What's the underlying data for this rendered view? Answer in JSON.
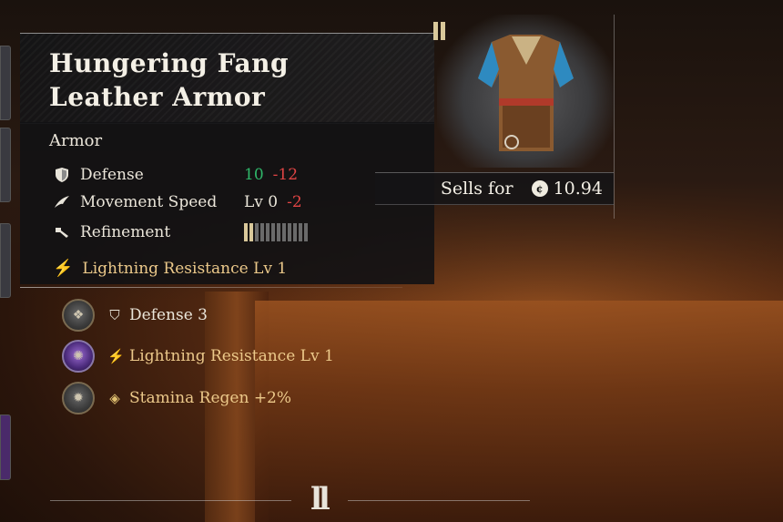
{
  "item": {
    "name_line1": "Hungering Fang",
    "name_line2": "Leather Armor",
    "category": "Armor"
  },
  "stats": [
    {
      "icon": "shield-icon",
      "label": "Defense",
      "value": "10",
      "delta": "-12"
    },
    {
      "icon": "wing-icon",
      "label": "Movement Speed",
      "value": "Lv 0",
      "delta": "-2"
    },
    {
      "icon": "hammer-icon",
      "label": "Refinement",
      "refinement_level": 2,
      "refinement_max": 12
    }
  ],
  "skill": {
    "icon": "lightning-icon",
    "label": "Lightning Resistance Lv 1"
  },
  "sells": {
    "label": "Sells for",
    "icon": "coin-icon",
    "amount": "10.94"
  },
  "runes": [
    {
      "rune_icon": "bronze-rune-icon",
      "effect_icon": "shield-icon",
      "label": "Defense 3"
    },
    {
      "rune_icon": "purple-rune-icon",
      "effect_icon": "lightning-icon",
      "label": "Lightning Resistance Lv 1"
    },
    {
      "rune_icon": "gray-rune-icon",
      "effect_icon": "stamina-diamond-icon",
      "label": "Stamina Regen +2%"
    }
  ],
  "colors": {
    "positive": "#2fb86a",
    "negative": "#e04444",
    "gold": "#ecc98a"
  }
}
